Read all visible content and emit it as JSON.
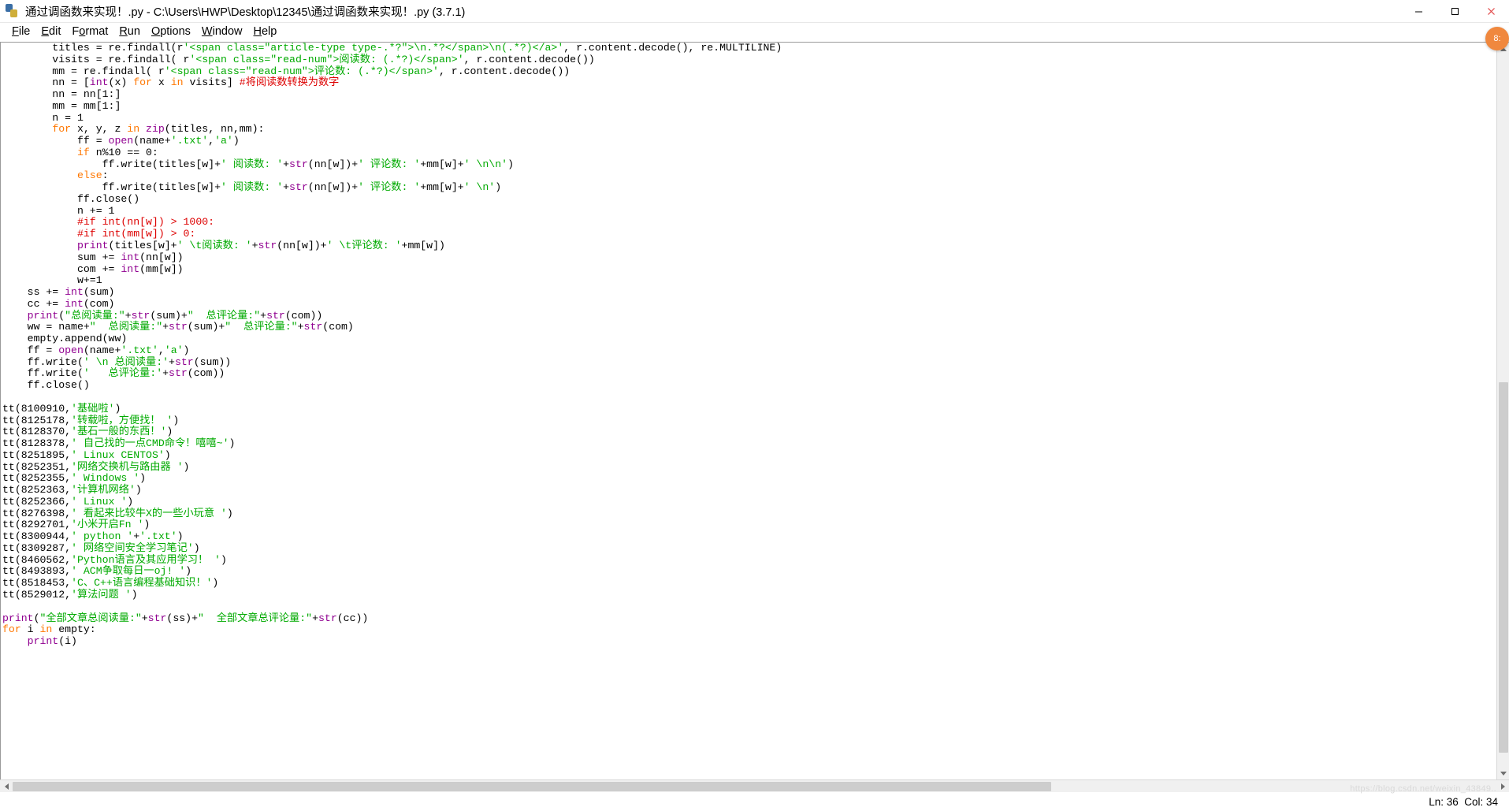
{
  "window": {
    "icon": "python-file-icon",
    "title": "通过调函数来实现！.py - C:\\Users\\HWP\\Desktop\\12345\\通过调函数来实现！.py (3.7.1)",
    "controls": {
      "minimize_label": "—",
      "maximize_label": "▢",
      "close_label": "✕"
    }
  },
  "menubar": {
    "items": [
      {
        "label": "File"
      },
      {
        "label": "Edit"
      },
      {
        "label": "Format"
      },
      {
        "label": "Run"
      },
      {
        "label": "Options"
      },
      {
        "label": "Window"
      },
      {
        "label": "Help"
      }
    ]
  },
  "editor": {
    "lines": [
      "        titles = re.findall(r'<span class=\"article-type type-.*?\">\\n.*?</span>\\n(.*?)</a>', r.content.decode(), re.MULTILINE)",
      "        visits = re.findall( r'<span class=\"read-num\">阅读数: (.*?)</span>', r.content.decode())",
      "        mm = re.findall( r'<span class=\"read-num\">评论数: (.*?)</span>', r.content.decode())",
      "        nn = [int(x) for x in visits] #将阅读数转换为数字",
      "        nn = nn[1:]",
      "        mm = mm[1:]",
      "        n = 1",
      "        for x, y, z in zip(titles, nn,mm):",
      "            ff = open(name+'.txt','a')",
      "            if n%10 == 0:",
      "                ff.write(titles[w]+' 阅读数: '+str(nn[w])+' 评论数: '+mm[w]+' \\n\\n')",
      "            else:",
      "                ff.write(titles[w]+' 阅读数: '+str(nn[w])+' 评论数: '+mm[w]+' \\n')",
      "            ff.close()",
      "            n += 1",
      "            #if int(nn[w]) > 1000:",
      "            #if int(mm[w]) > 0:",
      "            print(titles[w]+' \\t阅读数: '+str(nn[w])+' \\t评论数: '+mm[w])",
      "            sum += int(nn[w])",
      "            com += int(mm[w])",
      "            w+=1",
      "    ss += int(sum)",
      "    cc += int(com)",
      "    print(\"总阅读量:\"+str(sum)+\"  总评论量:\"+str(com))",
      "    ww = name+\"  总阅读量:\"+str(sum)+\"  总评论量:\"+str(com)",
      "    empty.append(ww)",
      "    ff = open(name+'.txt','a')",
      "    ff.write(' \\n 总阅读量:'+str(sum))",
      "    ff.write('   总评论量:'+str(com))",
      "    ff.close()",
      "",
      "tt(8100910,'基础啦')",
      "tt(8125178,'转载啦，方便找！ ')",
      "tt(8128370,'基石一般的东西！')",
      "tt(8128378,' 自己找的一点CMD命令！嘻嘻~')",
      "tt(8251895,' Linux CENTOS')",
      "tt(8252351,'网络交换机与路由器 ')",
      "tt(8252355,' Windows ')",
      "tt(8252363,'计算机网络')",
      "tt(8252366,' Linux ')",
      "tt(8276398,' 看起来比较牛X的一些小玩意 ')",
      "tt(8292701,'小米开启Fn ')",
      "tt(8300944,' python '+'.txt')",
      "tt(8309287,' 网络空间安全学习笔记')",
      "tt(8460562,'Python语言及其应用学习！ ')",
      "tt(8493893,' ACM争取每日一oj! ')",
      "tt(8518453,'C、C++语言编程基础知识！')",
      "tt(8529012,'算法问题 ')",
      "",
      "print(\"全部文章总阅读量:\"+str(ss)+\"  全部文章总评论量:\"+str(cc))",
      "for i in empty:",
      "    print(i)"
    ]
  },
  "statusbar": {
    "position": "Ln: 36  Col: 34"
  },
  "watermark": {
    "text": "https://blog.csdn.net/weixin_43849.."
  },
  "side_widget": {
    "label": "8:"
  },
  "colors": {
    "keyword": "#ff7700",
    "string": "#00aa00",
    "builtin": "#900090",
    "comment": "#dd0000",
    "definition": "#0000ff",
    "normal": "#000000",
    "background": "#ffffff",
    "accent": "#f0883e"
  }
}
